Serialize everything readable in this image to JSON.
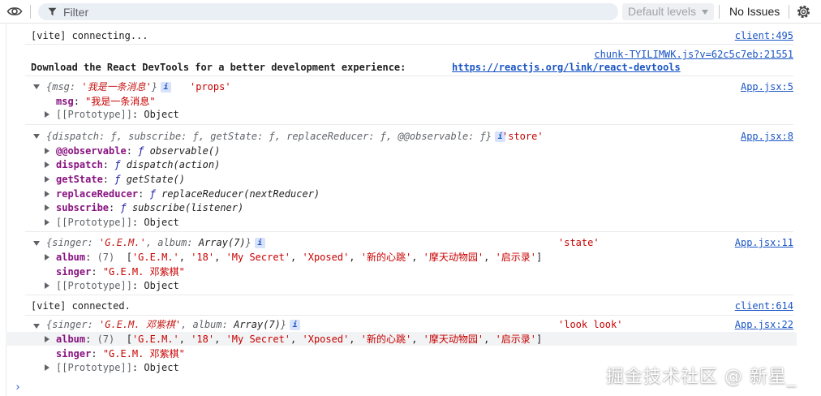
{
  "toolbar": {
    "filter_placeholder": "Filter",
    "levels_label": "Default levels",
    "issues_label": "No Issues"
  },
  "console": {
    "m1": {
      "text": "[vite] connecting...",
      "src": "client:495"
    },
    "m2": {
      "src": "chunk-TYILIMWK.js?v=62c5c7eb:21551",
      "text": "Download the React DevTools for a better experience: ",
      "text_full": "Download the React DevTools for a better development experience: ",
      "link": "https://reactjs.org/link/react-devtools"
    },
    "m3": {
      "summary_open": "{",
      "summary_key": "msg",
      "summary_val": "'我是一条消息'",
      "summary_close": "}",
      "label": "'props'",
      "src": "App.jsx:5",
      "prop_key": "msg",
      "prop_val": "\"我是一条消息\"",
      "proto_key": "[[Prototype]]",
      "proto_val": "Object"
    },
    "m4": {
      "summary": "{dispatch: ƒ, subscribe: ƒ, getState: ƒ, replaceReducer: ƒ, @@observable: ƒ}",
      "label": "'store'",
      "src": "App.jsx:8",
      "props": [
        {
          "key": "@@observable",
          "val": "observable()"
        },
        {
          "key": "dispatch",
          "val": "dispatch(action)"
        },
        {
          "key": "getState",
          "val": "getState()"
        },
        {
          "key": "replaceReducer",
          "val": "replaceReducer(nextReducer)"
        },
        {
          "key": "subscribe",
          "val": "subscribe(listener)"
        }
      ],
      "f_glyph": "ƒ",
      "proto_key": "[[Prototype]]",
      "proto_val": "Object"
    },
    "m5": {
      "summary_a": "{singer: ",
      "summary_singer": "'G.E.M.'",
      "summary_b": ", album: ",
      "summary_arr": "Array(7)",
      "summary_c": "}",
      "label": "'state'",
      "src": "App.jsx:11",
      "album_key": "album",
      "album_count": "(7)",
      "album_items": [
        "'G.E.M.'",
        "'18'",
        "'My Secret'",
        "'Xposed'",
        "'新的心跳'",
        "'摩天动物园'",
        "'启示录'"
      ],
      "singer_key": "singer",
      "singer_val": "\"G.E.M. 邓紫棋\"",
      "proto_key": "[[Prototype]]",
      "proto_val": "Object"
    },
    "m6": {
      "text": "[vite] connected.",
      "src": "client:614"
    },
    "m7": {
      "summary_a": "{singer: ",
      "summary_singer": "'G.E.M. 邓紫棋'",
      "summary_b": ", album: ",
      "summary_arr": "Array(7)",
      "summary_c": "}",
      "label": "'look look'",
      "src": "App.jsx:22",
      "album_key": "album",
      "album_count": "(7)",
      "album_items": [
        "'G.E.M.'",
        "'18'",
        "'My Secret'",
        "'Xposed'",
        "'新的心跳'",
        "'摩天动物园'",
        "'启示录'"
      ],
      "singer_key": "singer",
      "singer_val": "\"G.E.M. 邓紫棋\"",
      "proto_key": "[[Prototype]]",
      "proto_val": "Object"
    }
  },
  "watermark": "掘金技术社区 @ 新星_"
}
